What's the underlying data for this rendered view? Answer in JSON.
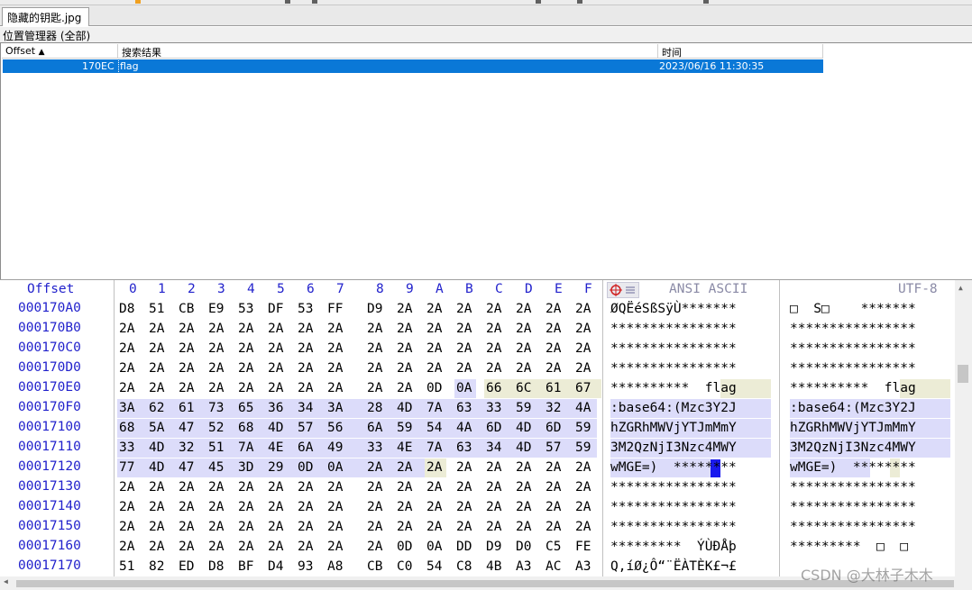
{
  "tab": {
    "filename": "隐藏的钥匙.jpg"
  },
  "position_manager": {
    "title": "位置管理器 (全部)",
    "columns": [
      "Offset",
      "搜索结果",
      "时间"
    ],
    "rows": [
      {
        "offset": "170EC",
        "result": "flag",
        "time": "2023/06/16   11:30:35"
      }
    ]
  },
  "hex_header": {
    "offset": "Offset",
    "cols": [
      "0",
      "1",
      "2",
      "3",
      "4",
      "5",
      "6",
      "7",
      "8",
      "9",
      "A",
      "B",
      "C",
      "D",
      "E",
      "F"
    ],
    "ansi_label": "ANSI ASCII",
    "utf_label": "UTF-8"
  },
  "hex_rows": [
    {
      "offset": "000170A0",
      "bytes": [
        "D8",
        "51",
        "CB",
        "E9",
        "53",
        "DF",
        "53",
        "FF",
        "D9",
        "2A",
        "2A",
        "2A",
        "2A",
        "2A",
        "2A",
        "2A"
      ],
      "ansi": "ØQËéSßSÿÙ*******",
      "utf": "□  S□    *******"
    },
    {
      "offset": "000170B0",
      "bytes": [
        "2A",
        "2A",
        "2A",
        "2A",
        "2A",
        "2A",
        "2A",
        "2A",
        "2A",
        "2A",
        "2A",
        "2A",
        "2A",
        "2A",
        "2A",
        "2A"
      ],
      "ansi": "****************",
      "utf": "****************"
    },
    {
      "offset": "000170C0",
      "bytes": [
        "2A",
        "2A",
        "2A",
        "2A",
        "2A",
        "2A",
        "2A",
        "2A",
        "2A",
        "2A",
        "2A",
        "2A",
        "2A",
        "2A",
        "2A",
        "2A"
      ],
      "ansi": "****************",
      "utf": "****************"
    },
    {
      "offset": "000170D0",
      "bytes": [
        "2A",
        "2A",
        "2A",
        "2A",
        "2A",
        "2A",
        "2A",
        "2A",
        "2A",
        "2A",
        "2A",
        "2A",
        "2A",
        "2A",
        "2A",
        "2A"
      ],
      "ansi": "****************",
      "utf": "****************"
    },
    {
      "offset": "000170E0",
      "bytes": [
        "2A",
        "2A",
        "2A",
        "2A",
        "2A",
        "2A",
        "2A",
        "2A",
        "2A",
        "2A",
        "0D",
        "0A",
        "66",
        "6C",
        "61",
        "67"
      ],
      "ansi": "**********  flag",
      "utf": "**********  flag"
    },
    {
      "offset": "000170F0",
      "bytes": [
        "3A",
        "62",
        "61",
        "73",
        "65",
        "36",
        "34",
        "3A",
        "28",
        "4D",
        "7A",
        "63",
        "33",
        "59",
        "32",
        "4A"
      ],
      "ansi": ":base64:(Mzc3Y2J",
      "utf": ":base64:(Mzc3Y2J"
    },
    {
      "offset": "00017100",
      "bytes": [
        "68",
        "5A",
        "47",
        "52",
        "68",
        "4D",
        "57",
        "56",
        "6A",
        "59",
        "54",
        "4A",
        "6D",
        "4D",
        "6D",
        "59"
      ],
      "ansi": "hZGRhMWVjYTJmMmY",
      "utf": "hZGRhMWVjYTJmMmY"
    },
    {
      "offset": "00017110",
      "bytes": [
        "33",
        "4D",
        "32",
        "51",
        "7A",
        "4E",
        "6A",
        "49",
        "33",
        "4E",
        "7A",
        "63",
        "34",
        "4D",
        "57",
        "59"
      ],
      "ansi": "3M2QzNjI3Nzc4MWY",
      "utf": "3M2QzNjI3Nzc4MWY"
    },
    {
      "offset": "00017120",
      "bytes": [
        "77",
        "4D",
        "47",
        "45",
        "3D",
        "29",
        "0D",
        "0A",
        "2A",
        "2A",
        "2A",
        "2A",
        "2A",
        "2A",
        "2A",
        "2A"
      ],
      "ansi": "wMGE=)  ********",
      "utf": "wMGE=)  ********"
    },
    {
      "offset": "00017130",
      "bytes": [
        "2A",
        "2A",
        "2A",
        "2A",
        "2A",
        "2A",
        "2A",
        "2A",
        "2A",
        "2A",
        "2A",
        "2A",
        "2A",
        "2A",
        "2A",
        "2A"
      ],
      "ansi": "****************",
      "utf": "****************"
    },
    {
      "offset": "00017140",
      "bytes": [
        "2A",
        "2A",
        "2A",
        "2A",
        "2A",
        "2A",
        "2A",
        "2A",
        "2A",
        "2A",
        "2A",
        "2A",
        "2A",
        "2A",
        "2A",
        "2A"
      ],
      "ansi": "****************",
      "utf": "****************"
    },
    {
      "offset": "00017150",
      "bytes": [
        "2A",
        "2A",
        "2A",
        "2A",
        "2A",
        "2A",
        "2A",
        "2A",
        "2A",
        "2A",
        "2A",
        "2A",
        "2A",
        "2A",
        "2A",
        "2A"
      ],
      "ansi": "****************",
      "utf": "****************"
    },
    {
      "offset": "00017160",
      "bytes": [
        "2A",
        "2A",
        "2A",
        "2A",
        "2A",
        "2A",
        "2A",
        "2A",
        "2A",
        "0D",
        "0A",
        "DD",
        "D9",
        "D0",
        "C5",
        "FE"
      ],
      "ansi": "*********  ÝÙÐÅþ",
      "utf": "*********  □  □"
    },
    {
      "offset": "00017170",
      "bytes": [
        "51",
        "82",
        "ED",
        "D8",
        "BF",
        "D4",
        "93",
        "A8",
        "CB",
        "C0",
        "54",
        "C8",
        "4B",
        "A3",
        "AC",
        "A3"
      ],
      "ansi": "Q‚íØ¿Ô“¨ËÀTÈK£¬£",
      "utf": ""
    }
  ],
  "watermark": "CSDN @大林子木木",
  "colors": {
    "selection": "#0a78d7",
    "highlight": "#dcdcfa",
    "offset_text": "#2222cc"
  }
}
